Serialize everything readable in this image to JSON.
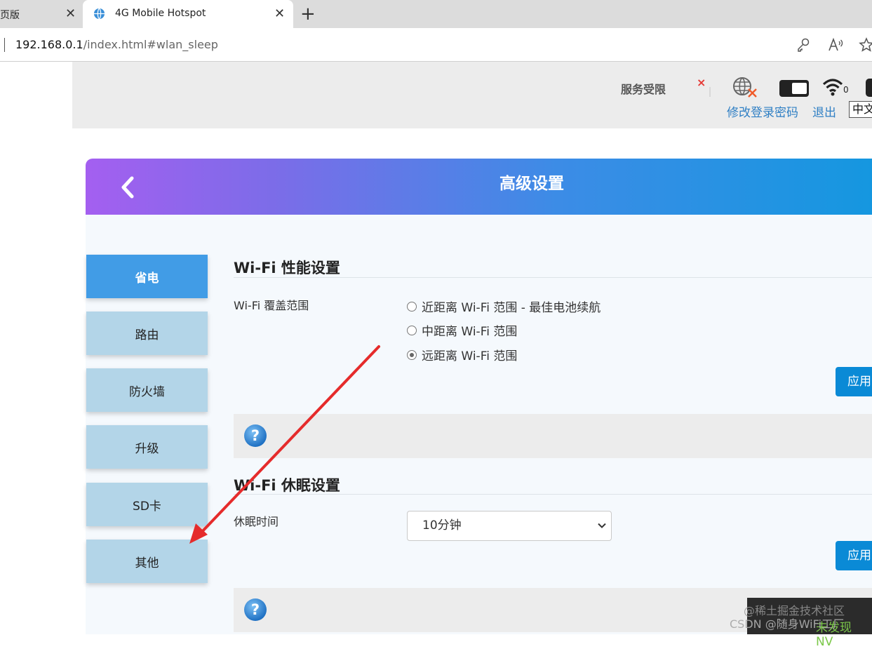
{
  "browser": {
    "tabs": [
      {
        "title": "页版"
      },
      {
        "title": "4G Mobile Hotspot"
      }
    ],
    "url_host": "192.168.0.1",
    "url_path": "/index.html#wlan_sleep",
    "new_tab_glyph": "+",
    "close_glyph": "✕",
    "toolbar_icons": [
      "key-icon",
      "read-aloud-icon",
      "favorite-star-icon"
    ]
  },
  "header": {
    "service_status": "服务受限",
    "sim_status_glyph": "×",
    "status_icons": [
      "globe-disconnected-icon",
      "battery-icon",
      "wifi-signal-icon",
      "device-icon"
    ],
    "wifi_clients": "0",
    "links": {
      "change_password": "修改登录密码",
      "logout": "退出"
    },
    "language": "中文"
  },
  "panel": {
    "title": "高级设置",
    "sidebar": [
      {
        "label": "省电",
        "active": true
      },
      {
        "label": "路由",
        "active": false
      },
      {
        "label": "防火墙",
        "active": false
      },
      {
        "label": "升级",
        "active": false
      },
      {
        "label": "SD卡",
        "active": false
      },
      {
        "label": "其他",
        "active": false
      }
    ]
  },
  "performance": {
    "title": "Wi-Fi 性能设置",
    "coverage_label": "Wi-Fi 覆盖范围",
    "options": [
      {
        "label": "近距离 Wi-Fi 范围 - 最佳电池续航",
        "checked": false
      },
      {
        "label": "中距离 Wi-Fi 范围",
        "checked": false
      },
      {
        "label": "远距离 Wi-Fi 范围",
        "checked": true
      }
    ],
    "apply": "应用"
  },
  "sleep": {
    "title": "Wi-Fi 休眠设置",
    "time_label": "休眠时间",
    "selected": "10分钟",
    "apply": "应用"
  },
  "overlay": {
    "corner_text": "未发现 NV",
    "watermark_line1": "@稀土掘金技术社区",
    "watermark_line2": "CSDN @随身WiFi工厂",
    "annotation_color": "#e52b2b"
  },
  "colors": {
    "accent": "#419ce6",
    "apply_button": "#0a8ad6",
    "link": "#2f7fc4",
    "sidebar_button": "#b3d5e8"
  }
}
